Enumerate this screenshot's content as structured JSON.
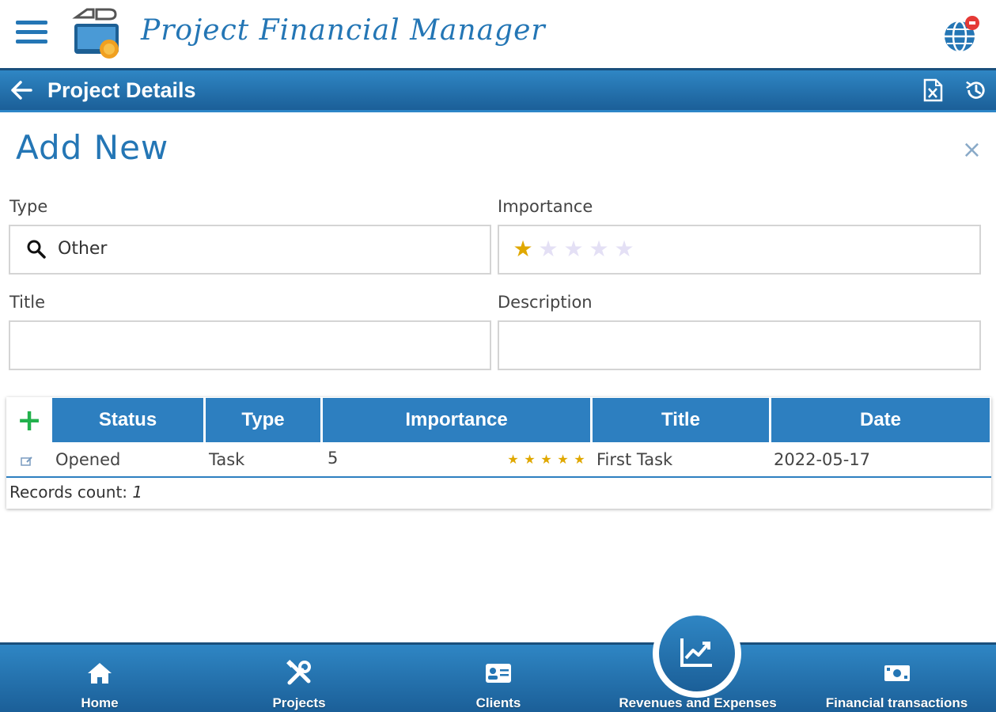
{
  "app": {
    "title": "Project Financial Manager"
  },
  "titlebar": {
    "title": "Project Details"
  },
  "form": {
    "heading": "Add New",
    "close_symbol": "×",
    "type": {
      "label": "Type",
      "value": "Other"
    },
    "importance": {
      "label": "Importance",
      "rating": 1,
      "max": 5
    },
    "title": {
      "label": "Title",
      "value": ""
    },
    "description": {
      "label": "Description",
      "value": ""
    }
  },
  "table": {
    "add_symbol": "+",
    "columns": [
      "Status",
      "Type",
      "Importance",
      "Title",
      "Date"
    ],
    "rows": [
      {
        "status": "Opened",
        "type": "Task",
        "importance": "5",
        "importance_stars": 5,
        "title": "First Task",
        "date": "2022-05-17"
      }
    ],
    "records_label": "Records count:",
    "records_count": "1"
  },
  "nav": {
    "items": [
      {
        "label": "Home",
        "icon": "home-icon"
      },
      {
        "label": "Projects",
        "icon": "tools-icon"
      },
      {
        "label": "Clients",
        "icon": "id-card-icon"
      },
      {
        "label": "Revenues and Expenses",
        "icon": "chart-icon"
      },
      {
        "label": "Financial transactions",
        "icon": "money-icon"
      }
    ]
  },
  "colors": {
    "primary": "#2476b5",
    "header_bar": "#2d7fc0",
    "star": "#e0a800",
    "star_empty": "#e4e0f5",
    "add": "#22b14c"
  }
}
